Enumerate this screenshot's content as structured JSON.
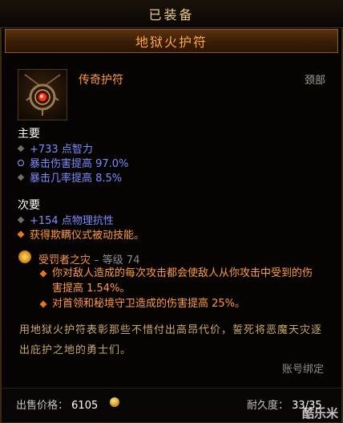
{
  "header": {
    "equipped": "已装备"
  },
  "item": {
    "name": "地狱火护符",
    "type": "传奇护符",
    "slot": "颈部",
    "icon": "amulet-icon"
  },
  "primary": {
    "title": "主要",
    "stats": [
      "+733 点智力",
      "暴击伤害提高 97.0%",
      "暴击几率提高 8.5%"
    ]
  },
  "secondary": {
    "title": "次要",
    "stats": [
      "+154 点物理抗性",
      "获得欺瞒仪式被动技能。"
    ]
  },
  "passive": {
    "name": "受罚者之灾",
    "level_text": "等级 74",
    "effects": [
      "你对敌人造成的每次攻击都会使敌人从你攻击中受到的伤害提高 1.54%。",
      "对首领和秘境守卫造成的伤害提高 25%。"
    ]
  },
  "flavor": "用地狱火护符表彰那些不惜付出高昂代价，誓死将恶魔天灾逐出庇护之地的勇士们。",
  "binding": "账号绑定",
  "footer": {
    "price_label": "出售价格：",
    "price_value": "6105",
    "durability_label": "耐久度：",
    "durability_value": "33/35"
  },
  "watermark": "酷乐米",
  "colors": {
    "legendary": "#ff9a3a",
    "magic": "#7d8cff",
    "border": "#8a5a22"
  }
}
